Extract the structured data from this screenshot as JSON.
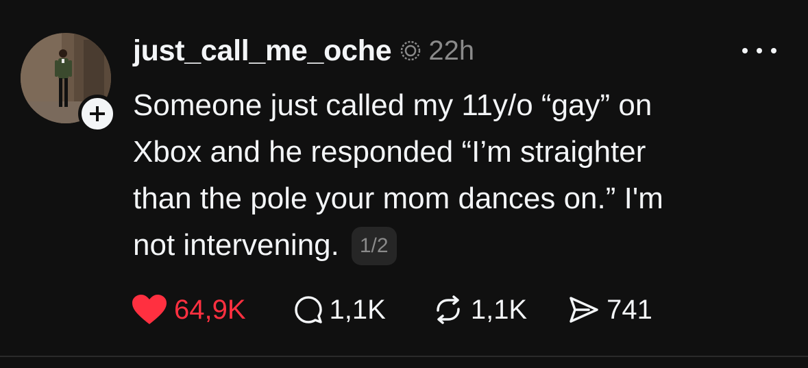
{
  "post": {
    "username": "just_call_me_oche",
    "time": "22h",
    "text_lines": [
      "Someone just called my 11y/o “gay” on",
      "Xbox and he responded “I’m straighter",
      "than the pole your mom dances on.” I'm",
      "not intervening."
    ],
    "page_indicator": "1/2"
  },
  "actions": {
    "likes": "64,9K",
    "replies": "1,1K",
    "reposts": "1,1K",
    "shares": "741"
  },
  "colors": {
    "background": "#101010",
    "text": "#f3f5f7",
    "muted": "#8a8a8a",
    "like": "#ff3040"
  },
  "icons": {
    "follow": "plus-icon",
    "verified_ring": "threads-ring-icon",
    "more": "more-dots-icon",
    "like": "heart-icon",
    "reply": "comment-icon",
    "repost": "repost-icon",
    "share": "send-icon"
  }
}
